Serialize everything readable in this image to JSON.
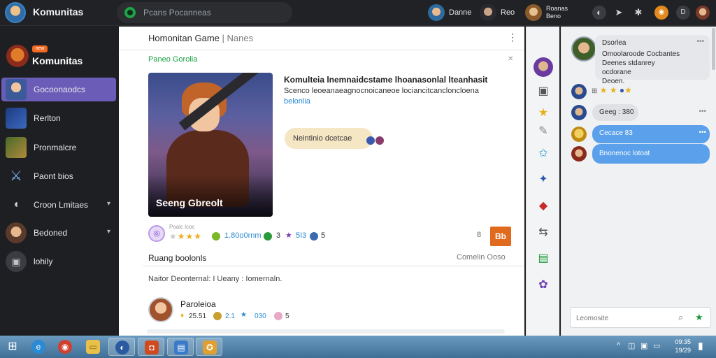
{
  "topbar": {
    "app_title": "Komunitas",
    "search_placeholder": "Pcans Pocanneas",
    "users": [
      {
        "name": "Danne"
      },
      {
        "name": "Reo"
      },
      {
        "name": "Roanas",
        "sub": "Beno"
      }
    ],
    "icons": [
      "settings-gear-icon",
      "compass-icon",
      "gear-icon",
      "badge-icon",
      "d-icon",
      "profile-icon"
    ]
  },
  "sidebar": {
    "server_name": "Komunitas",
    "server_badge": "new",
    "items": [
      {
        "label": "Gocoonaodcs",
        "active": true
      },
      {
        "label": "Rerlton"
      },
      {
        "label": "Pronmalcre"
      },
      {
        "label": "Paont bios"
      },
      {
        "label": "Croon Lmitaes",
        "chevron": true
      },
      {
        "label": "Bedoned",
        "chevron": true
      },
      {
        "label": "lohily"
      }
    ]
  },
  "main": {
    "title": "Homonitan Game",
    "title_sub": "Nanes",
    "section_label": "Paneo Gorolia",
    "card_caption": "Seeng Gbreolt",
    "post_title": "Komulteia lnemnaidcstame lhoanasonlal lteanhasit",
    "post_desc": "Scenco leoeanaeagnocnoicaneoe lociancitcancloncloena",
    "post_link": "belonlia",
    "bubble_text": "Neintinio dcetcae",
    "stats": {
      "text_top": "Poalc lcoc",
      "count1": "1.80o0rnm",
      "count2": "3",
      "count3": "5I3",
      "count4": "5",
      "rating": 4,
      "right_value": "8"
    },
    "orange_button": "Bb",
    "section2_title": "Ruang boolonls",
    "section2_link": "Comelin Ooso",
    "meta": "Naitor Deonternal: I Ueany : Iomernaln.",
    "user2": {
      "name": "Paroleioa",
      "s1": "25.51",
      "s2": "2.1",
      "s3": "030",
      "s4": "5"
    }
  },
  "rail": {
    "icons": [
      "avatar-icon",
      "window-icon",
      "star-icon",
      "feather-icon",
      "star-outline-icon",
      "star-blue-icon",
      "gem-icon",
      "share-icon",
      "calendar-icon",
      "plant-icon"
    ]
  },
  "chat": {
    "card": {
      "name": "Dsorlea",
      "body_l1": "Omoolaroode Cocbantes",
      "body_l2": "Deenes stdanrey ocdorane",
      "body_l3": "Deoen."
    },
    "messages": [
      {
        "text": ""
      },
      {
        "text": "Geeg : 380"
      },
      {
        "text": "Cecace 83"
      },
      {
        "text": "Bnonenoc lotoat"
      }
    ],
    "input_placeholder": "Leomosite"
  },
  "taskbar": {
    "clock_top": "09:35",
    "clock_bottom": "19/29"
  },
  "colors": {
    "accent": "#6b5cb8",
    "orange": "#e06a1e",
    "green_label": "#18a040",
    "chat_blue": "#5aa0ea"
  }
}
